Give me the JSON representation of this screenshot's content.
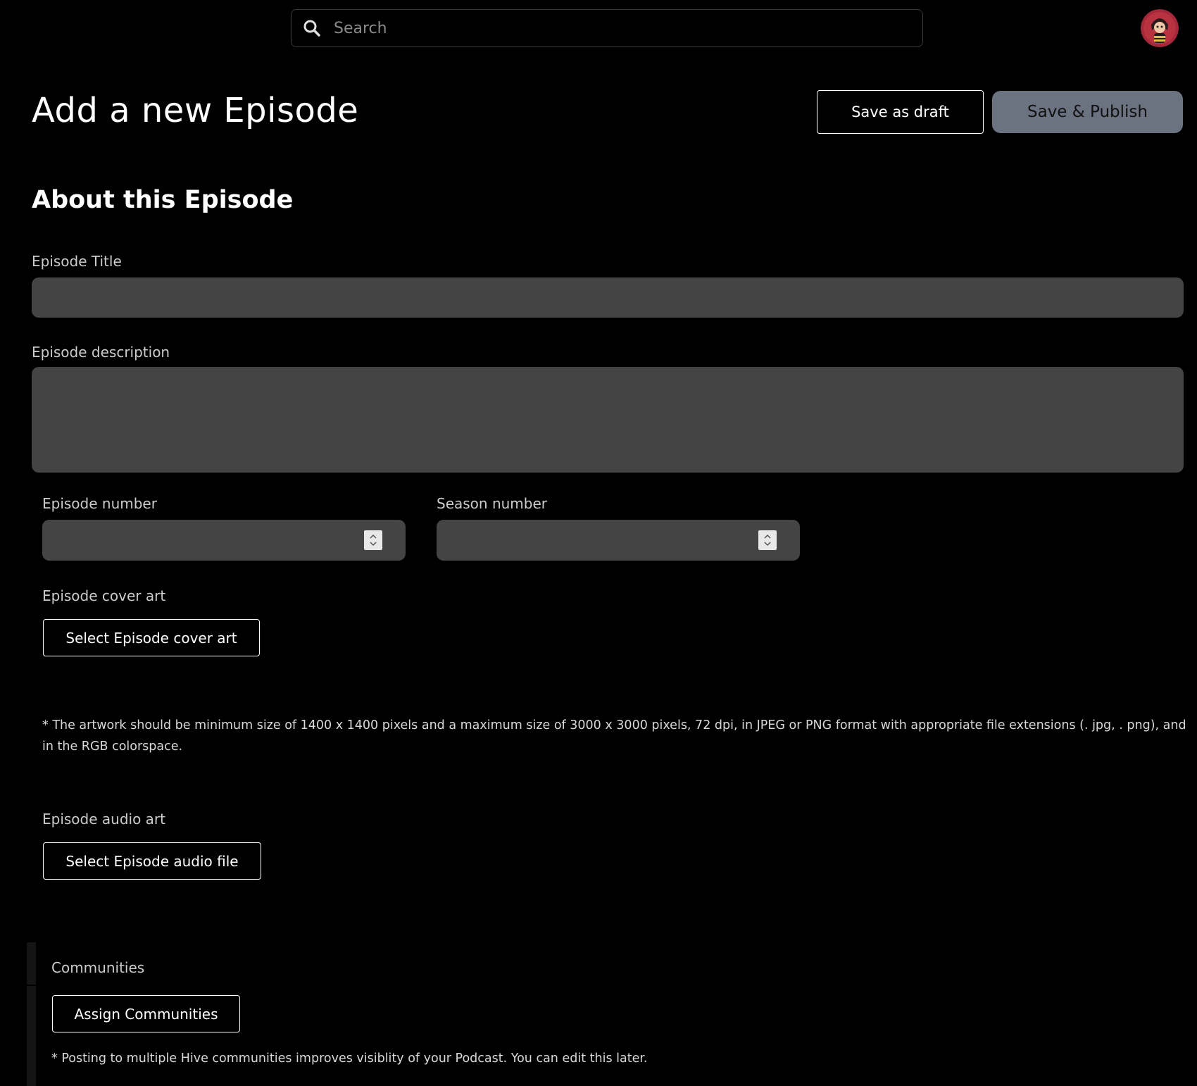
{
  "search": {
    "placeholder": "Search"
  },
  "header": {
    "title": "Add a new Episode",
    "save_draft_label": "Save as draft",
    "publish_label": "Save & Publish"
  },
  "form": {
    "section_title": "About this Episode",
    "episode_title_label": "Episode Title",
    "episode_title_value": "",
    "description_label": "Episode description",
    "description_value": "",
    "episode_number_label": "Episode number",
    "season_number_label": "Season number",
    "cover_art_label": "Episode cover art",
    "cover_art_button": "Select Episode cover art",
    "cover_art_note": "* The artwork should be minimum size of 1400 x 1400 pixels and a maximum size of 3000 x 3000 pixels, 72 dpi, in JPEG or PNG format with appropriate file extensions (. jpg, . png), and in the RGB colorspace.",
    "audio_label": "Episode audio art",
    "audio_button": "Select Episode audio file",
    "communities_label": "Communities",
    "communities_button": "Assign Communities",
    "communities_note": "* Posting to multiple Hive communities improves visiblity of your Podcast. You can edit this later."
  },
  "colors": {
    "background": "#000000",
    "field": "#444444",
    "publish_button": "#6b7280",
    "avatar": "#a3293a"
  },
  "icons": {
    "search": "search-icon",
    "avatar": "avatar",
    "spinner": "stepper-arrows-icon"
  }
}
